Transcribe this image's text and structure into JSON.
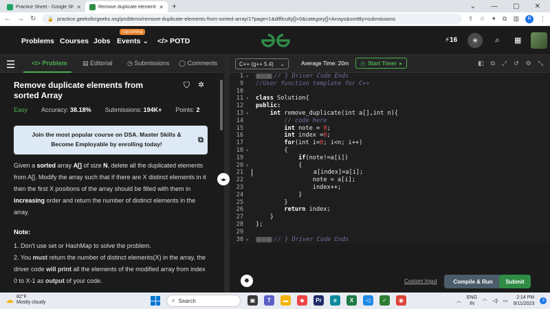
{
  "browser": {
    "tabs": [
      {
        "title": "Practice Sheet - Google Sheets",
        "color": "#1fa463"
      },
      {
        "title": "Remove duplicate elements from sorte",
        "color": "#2f8d46"
      }
    ],
    "url": "practice.geeksforgeeks.org/problems/remove-duplicate-elements-from-sorted-array/1?page=1&difficulty[]=0&category[]=Arrays&sortBy=submissions",
    "profile_initial": "R"
  },
  "site_nav": {
    "items": [
      "Problems",
      "Courses",
      "Jobs",
      "Events"
    ],
    "upcoming_badge": "Upcoming",
    "potd": "POTD",
    "streak": "16"
  },
  "problem": {
    "tabs": [
      "Problem",
      "Editorial",
      "Submissions",
      "Comments"
    ],
    "title": "Remove duplicate elements from sorted Array",
    "difficulty": "Easy",
    "accuracy_label": "Accuracy:",
    "accuracy": "38.18%",
    "submissions_label": "Submissions:",
    "submissions": "194K+",
    "points_label": "Points:",
    "points": "2",
    "banner": "Join the most popular course on DSA. Master Skills & Become Employable by enrolling today!",
    "desc": {
      "p1": "Given a ",
      "b1": "sorted",
      "p2": " array ",
      "b2": "A[]",
      "p3": " of size ",
      "b3": "N",
      "p4": ", delete all the duplicated elements from A[]. Modify the array such that if there are X distinct elements in it then the first X positions of the array should be filled with them in ",
      "b4": "increasing",
      "p5": " order and return the number of distinct elements in the array."
    },
    "note_heading": "Note:",
    "note1": "1. Don't use set or HashMap to solve the problem.",
    "note2": {
      "a": "2. You ",
      "b": "must",
      "c": " return the number of distinct elements(X) in the array, the driver code ",
      "d": "will print",
      "e": " all the elements of the modified array from index 0 to X-1 as ",
      "f": "output",
      "g": " of your code."
    }
  },
  "editor": {
    "language": "C++ (g++ 5.4)",
    "avg_time": "Average Time: 20m",
    "timer": "Start Timer",
    "custom_input": "Custom Input",
    "compile_run": "Compile & Run",
    "submit": "Submit",
    "lines": [
      {
        "n": "1",
        "fold": "▸",
        "badge": "(···)",
        "cm": "// } Driver Code Ends"
      },
      {
        "n": "9",
        "cm": "//User function template for C++"
      },
      {
        "n": "10"
      },
      {
        "n": "11",
        "fold": "▾",
        "kw": "class",
        "rest": " Solution{"
      },
      {
        "n": "12",
        "kw": "public:"
      },
      {
        "n": "13",
        "fold": "▾",
        "indent": "    ",
        "kw": "int",
        "rest": " remove_duplicate(int a[],int n){"
      },
      {
        "n": "14",
        "indent": "        ",
        "cm": "// code here"
      },
      {
        "n": "15",
        "indent": "        ",
        "kw": "int",
        "rest": " note = ",
        "num": "0",
        "tail": ";"
      },
      {
        "n": "16",
        "indent": "        ",
        "kw": "int",
        "rest": " index =",
        "num": "0",
        "tail": ";"
      },
      {
        "n": "17",
        "indent": "        ",
        "kw": "for",
        "rest": "(int i=",
        "num": "0",
        "tail": "; i<n; i++)"
      },
      {
        "n": "18",
        "fold": "▾",
        "indent": "        ",
        "rest": "{"
      },
      {
        "n": "19",
        "indent": "            ",
        "kw": "if",
        "rest": "(note!=a[i])"
      },
      {
        "n": "20",
        "fold": "▾",
        "indent": "            ",
        "rest": "{"
      },
      {
        "n": "21",
        "indent": "                ",
        "rest": "a[index]=a[i];",
        "cursor": true
      },
      {
        "n": "22",
        "indent": "                ",
        "rest": "note = a[i];"
      },
      {
        "n": "23",
        "indent": "                ",
        "rest": "index++;"
      },
      {
        "n": "24",
        "indent": "            ",
        "rest": "}"
      },
      {
        "n": "25",
        "indent": "        ",
        "rest": "}"
      },
      {
        "n": "26",
        "indent": "        ",
        "kw": "return",
        "rest": " index;"
      },
      {
        "n": "27",
        "indent": "    ",
        "rest": "}"
      },
      {
        "n": "28",
        "rest": "};"
      },
      {
        "n": "29"
      },
      {
        "n": "30",
        "fold": "▸",
        "badge": "(···)",
        "cm": "// } Driver Code Ends"
      }
    ]
  },
  "taskbar": {
    "temp": "82°F",
    "weather": "Mostly cloudy",
    "search_placeholder": "Search",
    "lang1": "ENG",
    "lang2": "IN",
    "time": "2:14 PM",
    "date": "9/11/2023",
    "notif": "3"
  }
}
